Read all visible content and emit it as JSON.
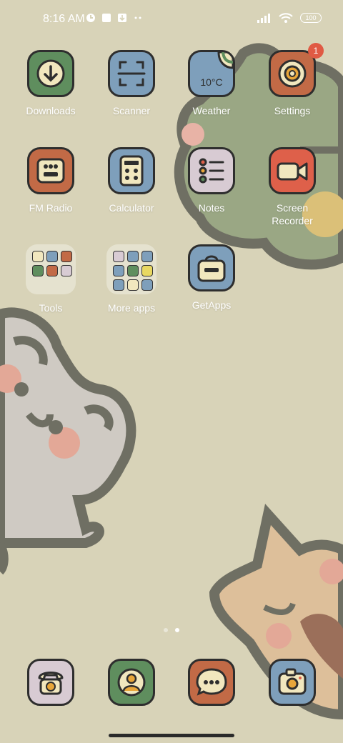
{
  "status": {
    "time": "8:16 AM",
    "battery": "100",
    "left_icons": [
      "clock-icon",
      "notification-square-icon",
      "download-box-icon",
      "more-dots-icon"
    ],
    "right_icons": [
      "signal-icon",
      "wifi-icon",
      "battery-icon"
    ]
  },
  "apps": [
    {
      "id": "downloads",
      "label": "Downloads",
      "icon": "download-arrow-icon",
      "color": "#5f8e5e"
    },
    {
      "id": "scanner",
      "label": "Scanner",
      "icon": "scan-frame-icon",
      "color": "#7e9fbb"
    },
    {
      "id": "weather",
      "label": "Weather",
      "icon": "weather-icon",
      "color": "#7e9fbb",
      "text": "10°C"
    },
    {
      "id": "settings",
      "label": "Settings",
      "icon": "gear-icon",
      "color": "#c26a46",
      "badge": "1"
    },
    {
      "id": "fm-radio",
      "label": "FM Radio",
      "icon": "radio-icon",
      "color": "#c26a46"
    },
    {
      "id": "calculator",
      "label": "Calculator",
      "icon": "calculator-icon",
      "color": "#7e9fbb"
    },
    {
      "id": "notes",
      "label": "Notes",
      "icon": "list-icon",
      "color": "#d8cbd3"
    },
    {
      "id": "screen-recorder",
      "label_line1": "Screen",
      "label_line2": "Recorder",
      "icon": "video-camera-icon",
      "color": "#de604a"
    },
    {
      "id": "getapps",
      "label": "GetApps",
      "icon": "shopping-bag-icon",
      "color": "#7e9fbb"
    }
  ],
  "folders": [
    {
      "id": "tools",
      "label": "Tools"
    },
    {
      "id": "more-apps",
      "label": "More apps"
    }
  ],
  "dock": [
    {
      "id": "phone",
      "icon": "telephone-icon",
      "color": "#d8cbd3"
    },
    {
      "id": "contacts",
      "icon": "contact-icon",
      "color": "#5f8e5e"
    },
    {
      "id": "messages",
      "icon": "message-bubble-icon",
      "color": "#c26a46"
    },
    {
      "id": "camera",
      "icon": "camera-icon",
      "color": "#7e9fbb"
    }
  ],
  "page_indicator": {
    "pages": 2,
    "active": 2
  },
  "colors": {
    "background": "#d8d3b8",
    "outline": "#2e2e2e",
    "cream": "#f1e7be",
    "label": "#ffffff"
  }
}
